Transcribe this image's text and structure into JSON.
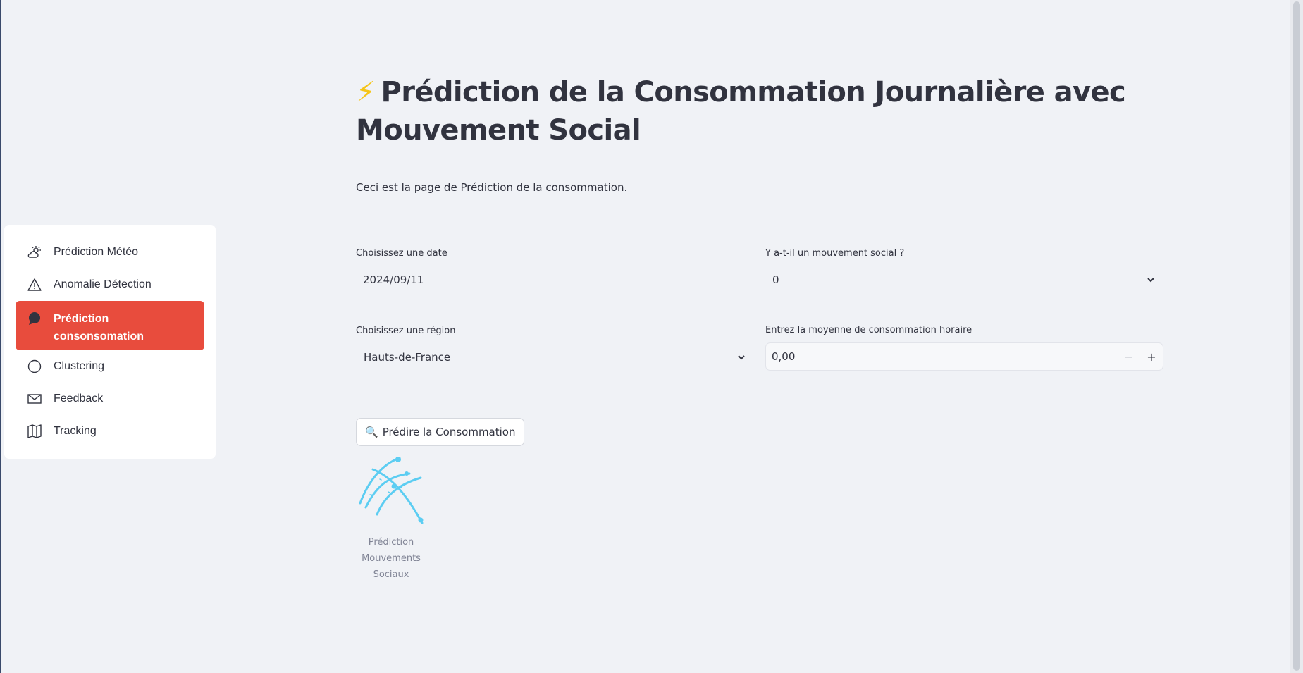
{
  "sidebar": {
    "items": [
      {
        "label": "Prédiction Météo",
        "icon": "cloud-sun-icon",
        "active": false
      },
      {
        "label": "Anomalie Détection",
        "icon": "warning-triangle-icon",
        "active": false
      },
      {
        "label": "Prédiction consonsomation",
        "icon": "chat-bubble-icon",
        "active": true
      },
      {
        "label": "Clustering",
        "icon": "circle-icon",
        "active": false
      },
      {
        "label": "Feedback",
        "icon": "envelope-icon",
        "active": false
      },
      {
        "label": "Tracking",
        "icon": "map-icon",
        "active": false
      }
    ],
    "active_color": "#e84c3d"
  },
  "main": {
    "title_icon": "⚡",
    "title": "Prédiction de la Consommation Journalière avec Mouvement Social",
    "subtitle": "Ceci est la page de Prédiction de la consommation.",
    "date_field": {
      "label": "Choisissez une date",
      "value": "2024/09/11"
    },
    "social_field": {
      "label": "Y a-t-il un mouvement social ?",
      "value": "0"
    },
    "region_field": {
      "label": "Choisissez une région",
      "value": "Hauts-de-France"
    },
    "consumption_field": {
      "label": "Entrez la moyenne de consommation horaire",
      "value": "0,00",
      "minus": "−",
      "plus": "+"
    },
    "predict_button": {
      "icon": "🔍",
      "label": "Prédire la Consommation"
    },
    "logo_caption": "Prédiction Mouvements Sociaux"
  }
}
